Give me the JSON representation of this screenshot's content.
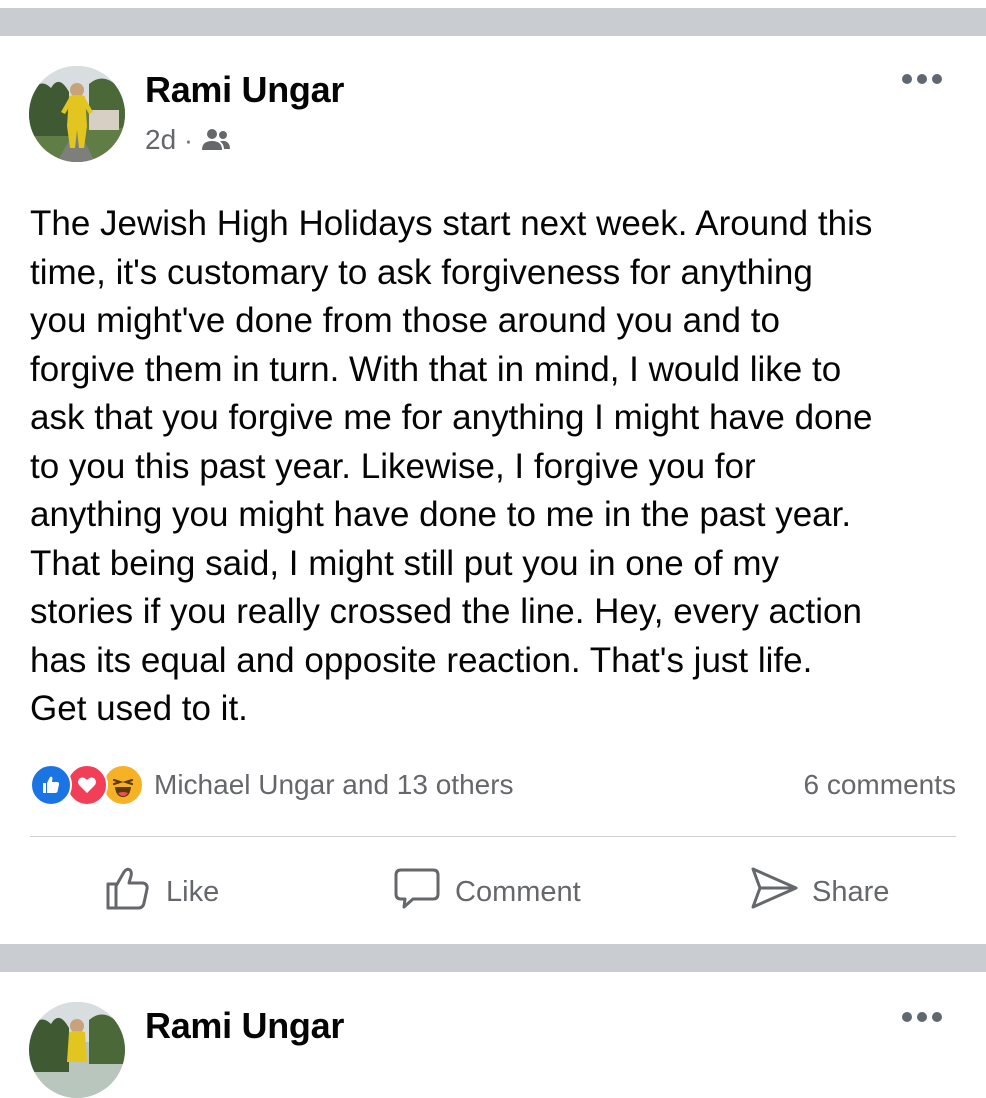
{
  "post": {
    "author": "Rami Ungar",
    "time": "2d",
    "separator": "·",
    "audience_icon": "friends-icon",
    "more_icon": "more-options-icon",
    "body": "The Jewish High Holidays start next week. Around this\ntime, it's customary to ask forgiveness for anything\nyou might've done from those around you and to\nforgive them in turn. With that in mind, I would like to\nask that you forgive me for anything I might have done\nto you this past year. Likewise, I forgive you for\nanything you might have done to me in the past year.\nThat being said, I might still put you in one of my\nstories if you really crossed the line. Hey, every action\nhas its equal and opposite reaction. That's just life.\nGet used to it.",
    "reactions": {
      "types": [
        "like",
        "love",
        "haha"
      ],
      "summary": "Michael Ungar and 13 others",
      "comments": "6 comments"
    },
    "actions": {
      "like": "Like",
      "comment": "Comment",
      "share": "Share"
    }
  },
  "next_post": {
    "author": "Rami Ungar"
  },
  "colors": {
    "like": "#1b74e4",
    "love": "#f33e58",
    "haha": "#f7b125",
    "secondary_text": "#65676b",
    "separator": "#c9ccd1"
  }
}
